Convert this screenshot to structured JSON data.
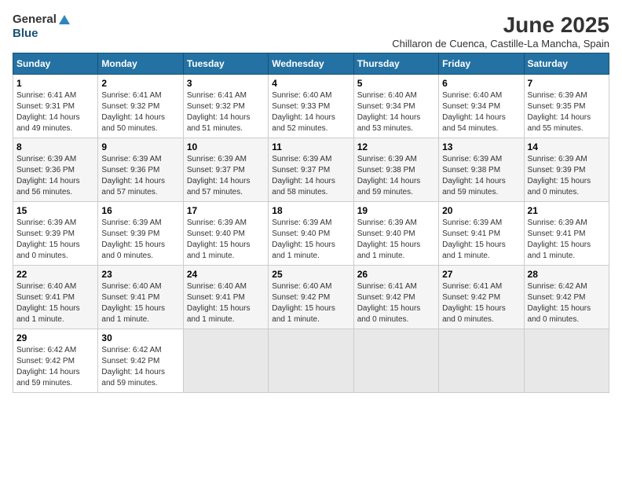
{
  "header": {
    "logo_general": "General",
    "logo_blue": "Blue",
    "month_title": "June 2025",
    "subtitle": "Chillaron de Cuenca, Castille-La Mancha, Spain"
  },
  "days_of_week": [
    "Sunday",
    "Monday",
    "Tuesday",
    "Wednesday",
    "Thursday",
    "Friday",
    "Saturday"
  ],
  "weeks": [
    [
      {
        "day": "1",
        "sunrise": "6:41 AM",
        "sunset": "9:31 PM",
        "daylight": "14 hours and 49 minutes."
      },
      {
        "day": "2",
        "sunrise": "6:41 AM",
        "sunset": "9:32 PM",
        "daylight": "14 hours and 50 minutes."
      },
      {
        "day": "3",
        "sunrise": "6:41 AM",
        "sunset": "9:32 PM",
        "daylight": "14 hours and 51 minutes."
      },
      {
        "day": "4",
        "sunrise": "6:40 AM",
        "sunset": "9:33 PM",
        "daylight": "14 hours and 52 minutes."
      },
      {
        "day": "5",
        "sunrise": "6:40 AM",
        "sunset": "9:34 PM",
        "daylight": "14 hours and 53 minutes."
      },
      {
        "day": "6",
        "sunrise": "6:40 AM",
        "sunset": "9:34 PM",
        "daylight": "14 hours and 54 minutes."
      },
      {
        "day": "7",
        "sunrise": "6:39 AM",
        "sunset": "9:35 PM",
        "daylight": "14 hours and 55 minutes."
      }
    ],
    [
      {
        "day": "8",
        "sunrise": "6:39 AM",
        "sunset": "9:36 PM",
        "daylight": "14 hours and 56 minutes."
      },
      {
        "day": "9",
        "sunrise": "6:39 AM",
        "sunset": "9:36 PM",
        "daylight": "14 hours and 57 minutes."
      },
      {
        "day": "10",
        "sunrise": "6:39 AM",
        "sunset": "9:37 PM",
        "daylight": "14 hours and 57 minutes."
      },
      {
        "day": "11",
        "sunrise": "6:39 AM",
        "sunset": "9:37 PM",
        "daylight": "14 hours and 58 minutes."
      },
      {
        "day": "12",
        "sunrise": "6:39 AM",
        "sunset": "9:38 PM",
        "daylight": "14 hours and 59 minutes."
      },
      {
        "day": "13",
        "sunrise": "6:39 AM",
        "sunset": "9:38 PM",
        "daylight": "14 hours and 59 minutes."
      },
      {
        "day": "14",
        "sunrise": "6:39 AM",
        "sunset": "9:39 PM",
        "daylight": "15 hours and 0 minutes."
      }
    ],
    [
      {
        "day": "15",
        "sunrise": "6:39 AM",
        "sunset": "9:39 PM",
        "daylight": "15 hours and 0 minutes."
      },
      {
        "day": "16",
        "sunrise": "6:39 AM",
        "sunset": "9:39 PM",
        "daylight": "15 hours and 0 minutes."
      },
      {
        "day": "17",
        "sunrise": "6:39 AM",
        "sunset": "9:40 PM",
        "daylight": "15 hours and 1 minute."
      },
      {
        "day": "18",
        "sunrise": "6:39 AM",
        "sunset": "9:40 PM",
        "daylight": "15 hours and 1 minute."
      },
      {
        "day": "19",
        "sunrise": "6:39 AM",
        "sunset": "9:40 PM",
        "daylight": "15 hours and 1 minute."
      },
      {
        "day": "20",
        "sunrise": "6:39 AM",
        "sunset": "9:41 PM",
        "daylight": "15 hours and 1 minute."
      },
      {
        "day": "21",
        "sunrise": "6:39 AM",
        "sunset": "9:41 PM",
        "daylight": "15 hours and 1 minute."
      }
    ],
    [
      {
        "day": "22",
        "sunrise": "6:40 AM",
        "sunset": "9:41 PM",
        "daylight": "15 hours and 1 minute."
      },
      {
        "day": "23",
        "sunrise": "6:40 AM",
        "sunset": "9:41 PM",
        "daylight": "15 hours and 1 minute."
      },
      {
        "day": "24",
        "sunrise": "6:40 AM",
        "sunset": "9:41 PM",
        "daylight": "15 hours and 1 minute."
      },
      {
        "day": "25",
        "sunrise": "6:40 AM",
        "sunset": "9:42 PM",
        "daylight": "15 hours and 1 minute."
      },
      {
        "day": "26",
        "sunrise": "6:41 AM",
        "sunset": "9:42 PM",
        "daylight": "15 hours and 0 minutes."
      },
      {
        "day": "27",
        "sunrise": "6:41 AM",
        "sunset": "9:42 PM",
        "daylight": "15 hours and 0 minutes."
      },
      {
        "day": "28",
        "sunrise": "6:42 AM",
        "sunset": "9:42 PM",
        "daylight": "15 hours and 0 minutes."
      }
    ],
    [
      {
        "day": "29",
        "sunrise": "6:42 AM",
        "sunset": "9:42 PM",
        "daylight": "14 hours and 59 minutes."
      },
      {
        "day": "30",
        "sunrise": "6:42 AM",
        "sunset": "9:42 PM",
        "daylight": "14 hours and 59 minutes."
      },
      null,
      null,
      null,
      null,
      null
    ]
  ]
}
